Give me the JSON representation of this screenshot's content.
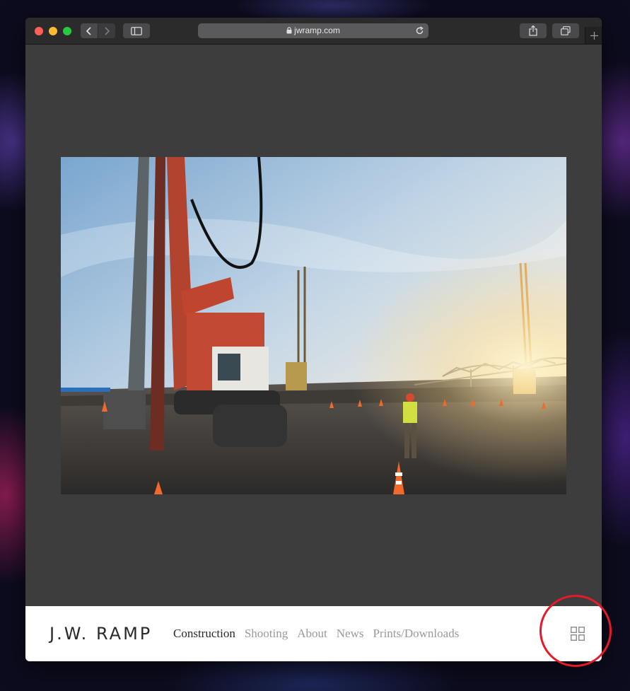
{
  "browser": {
    "url": "jwramp.com",
    "icons": {
      "back": "chevron-left-icon",
      "forward": "chevron-right-icon",
      "sidebar": "sidebar-icon",
      "lock": "lock-icon",
      "reload": "reload-icon",
      "share": "share-icon",
      "tabs": "tab-overview-icon",
      "new_tab": "plus-icon"
    }
  },
  "site": {
    "brand": "J.W. RAMP",
    "nav": [
      {
        "label": "Construction",
        "active": true
      },
      {
        "label": "Shooting",
        "active": false
      },
      {
        "label": "About",
        "active": false
      },
      {
        "label": "News",
        "active": false
      },
      {
        "label": "Prints/Downloads",
        "active": false
      }
    ],
    "grid_icon": "grid-icon",
    "hero_image": "construction site with pile-driving rigs, worker and bridge at sunrise"
  },
  "colors": {
    "page_bg": "#3d3d3d",
    "footer_bg": "#ffffff",
    "nav_active": "#2a2a2a",
    "nav_inactive": "#9a9a9a",
    "annotation": "#e6192a"
  }
}
